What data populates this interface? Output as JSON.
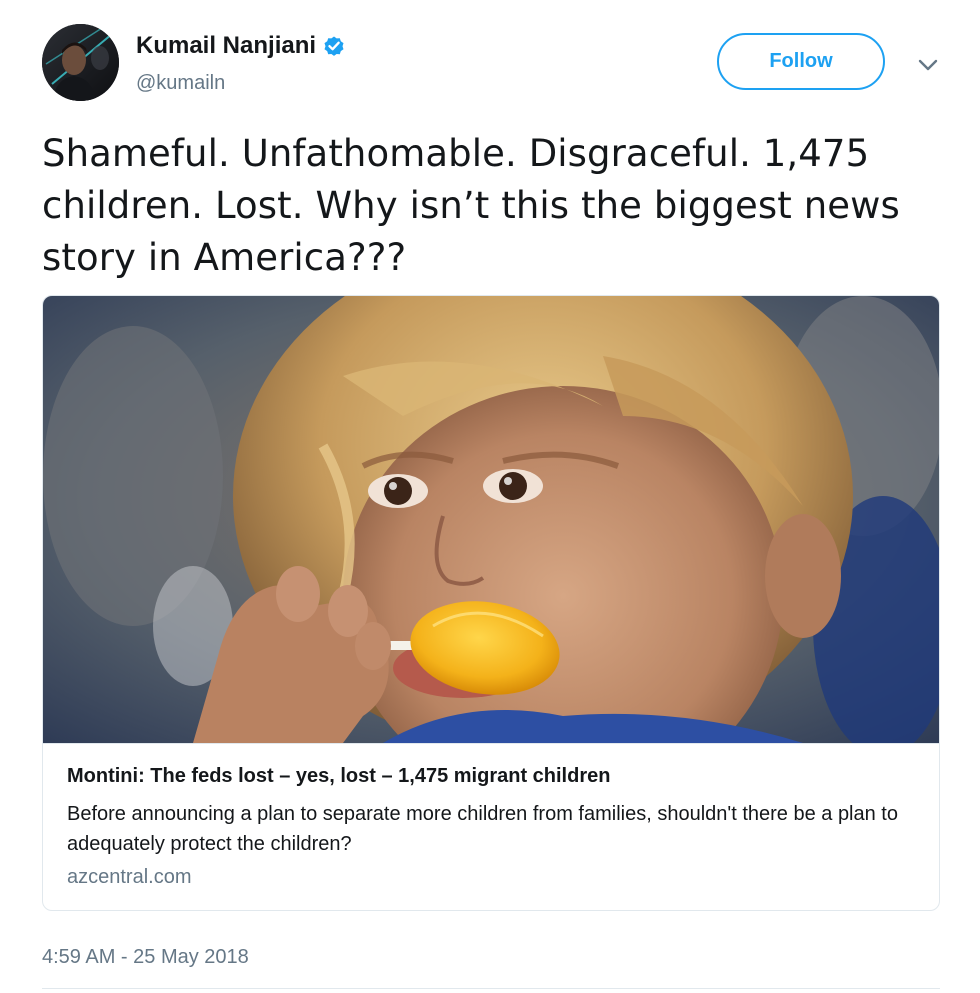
{
  "author": {
    "name": "Kumail Nanjiani",
    "handle": "@kumailn",
    "verified": true,
    "verified_color": "#1da1f2",
    "avatar_icon": "user-avatar"
  },
  "actions": {
    "follow_label": "Follow",
    "follow_color": "#1da1f2",
    "menu_icon": "chevron-down-icon"
  },
  "tweet": {
    "text": "Shameful. Unfathomable. Disgraceful. 1,475 children. Lost. Why isn’t this the biggest news story in America???",
    "timestamp": "4:59 AM - 25 May 2018"
  },
  "card": {
    "image_icon": "child-with-lollipop-photo",
    "title": "Montini: The feds lost – yes, lost – 1,475 migrant children",
    "description": "Before announcing a plan to separate more children from families, shouldn't there be a plan to adequately protect the children?",
    "domain": "azcentral.com"
  },
  "colors": {
    "text_primary": "#14171a",
    "text_secondary": "#657786",
    "border": "#e1e8ed"
  }
}
